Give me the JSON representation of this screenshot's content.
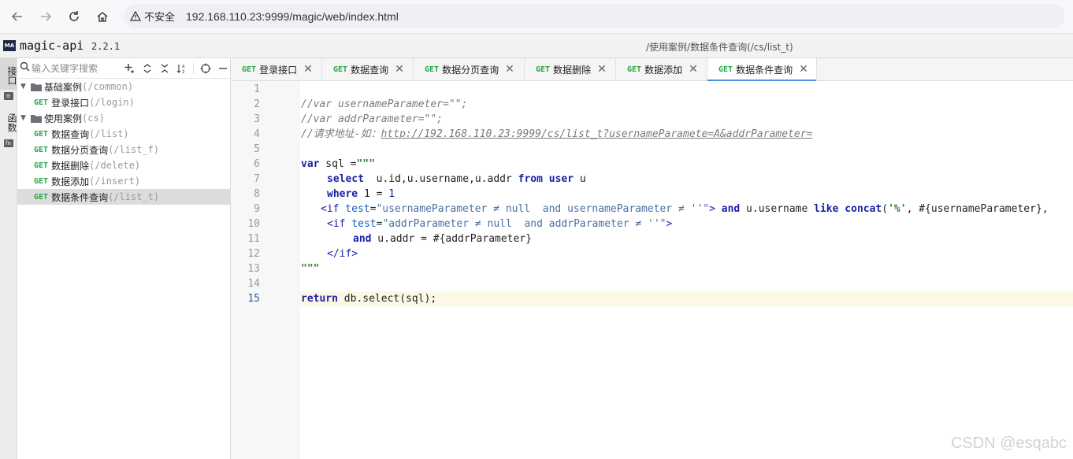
{
  "browser": {
    "security_label": "不安全",
    "url": "192.168.110.23:9999/magic/web/index.html"
  },
  "app": {
    "logo_text": "MA",
    "title": "magic-api",
    "version": "2.2.1",
    "current_path": "/使用案例/数据条件查询(/cs/list_t)"
  },
  "rail": {
    "tab_api": "接口",
    "tab_function": "函数",
    "fn_badge": "fn"
  },
  "sidebar": {
    "search_placeholder": "输入关键字搜索",
    "groups": [
      {
        "name": "基础案例",
        "path": "(/common)",
        "items": [
          {
            "method": "GET",
            "name": "登录接口",
            "path": "(/login)"
          }
        ]
      },
      {
        "name": "使用案例",
        "path": "(cs)",
        "items": [
          {
            "method": "GET",
            "name": "数据查询",
            "path": "(/list)"
          },
          {
            "method": "GET",
            "name": "数据分页查询",
            "path": "(/list_f)"
          },
          {
            "method": "GET",
            "name": "数据删除",
            "path": "(/delete)"
          },
          {
            "method": "GET",
            "name": "数据添加",
            "path": "(/insert)"
          },
          {
            "method": "GET",
            "name": "数据条件查询",
            "path": "(/list_t)"
          }
        ]
      }
    ]
  },
  "tabs": [
    {
      "method": "GET",
      "label": "登录接口"
    },
    {
      "method": "GET",
      "label": "数据查询"
    },
    {
      "method": "GET",
      "label": "数据分页查询"
    },
    {
      "method": "GET",
      "label": "数据删除"
    },
    {
      "method": "GET",
      "label": "数据添加"
    },
    {
      "method": "GET",
      "label": "数据条件查询"
    }
  ],
  "editor": {
    "line_numbers": [
      "1",
      "2",
      "3",
      "4",
      "5",
      "6",
      "7",
      "8",
      "9",
      "10",
      "11",
      "12",
      "13",
      "14",
      "15"
    ],
    "current_line": "15",
    "code": {
      "l2": "//var usernameParameter=\"\";",
      "l3": "//var addrParameter=\"\";",
      "l4_prefix": "//请求地址-如：",
      "l4_link": "http://192.168.110.23:9999/cs/list_t?usernameParamete=A&addrParameter=",
      "l6_kw": "var",
      "l6_rest": " sql =",
      "l6_str": "\"\"\"",
      "l7_kw1": "select",
      "l7_mid": "  u.id,u.username,u.addr ",
      "l7_kw2": "from",
      "l7_sp": " ",
      "l7_kw3": "user",
      "l7_end": " u",
      "l8_kw": "where",
      "l8_mid": " 1 = ",
      "l8_num": "1",
      "l9_open": "<if",
      "l9_attr": " test",
      "l9_eq": "=",
      "l9_val": "\"usernameParameter ≠ null  and usernameParameter ≠ ''\"",
      "l9_close": ">",
      "l9_kw1": " and",
      "l9_mid": " u.username ",
      "l9_kw2": "like",
      "l9_sp": " ",
      "l9_kw3": "concat",
      "l9_paren": "(",
      "l9_str": "'%'",
      "l9_tail": ", #{usernameParameter},",
      "l10_open": "<if",
      "l10_attr": " test",
      "l10_eq": "=",
      "l10_val": "\"addrParameter ≠ null  and addrParameter ≠ ''\"",
      "l10_close": ">",
      "l11_kw": "and",
      "l11_rest": " u.addr = #{addrParameter}",
      "l12_tag": "</if>",
      "l13_str": "\"\"\"",
      "l15_kw": "return",
      "l15_rest": " db.select(sql);"
    }
  },
  "watermark": "CSDN @esqabc"
}
